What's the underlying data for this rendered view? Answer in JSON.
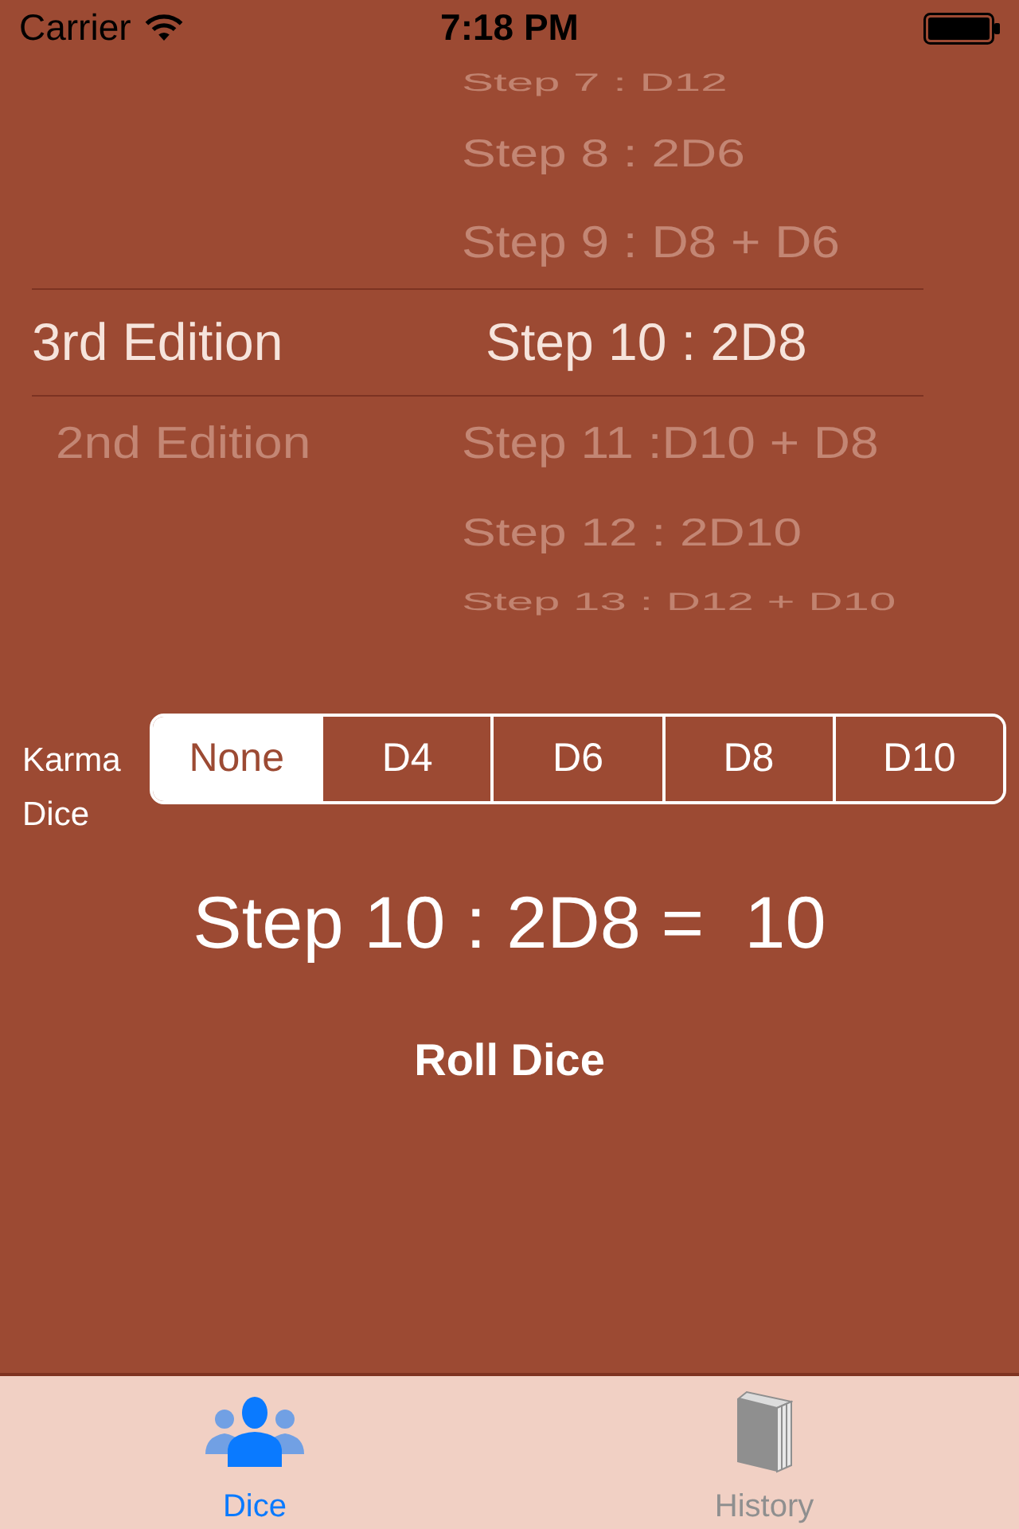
{
  "status_bar": {
    "carrier": "Carrier",
    "time": "7:18 PM"
  },
  "picker": {
    "editions": [
      {
        "label": "3rd Edition",
        "selected": true
      },
      {
        "label": "2nd Edition",
        "selected": false
      }
    ],
    "steps": [
      {
        "label": "Step 7 : D12",
        "selected": false
      },
      {
        "label": "Step 8 : 2D6",
        "selected": false
      },
      {
        "label": "Step 9 : D8 + D6",
        "selected": false
      },
      {
        "label": "Step 10 : 2D8",
        "selected": true
      },
      {
        "label": "Step 11 :D10 + D8",
        "selected": false
      },
      {
        "label": "Step 12 : 2D10",
        "selected": false
      },
      {
        "label": "Step 13 : D12 + D10",
        "selected": false
      }
    ]
  },
  "karma": {
    "label": "Karma Dice",
    "options": [
      {
        "label": "None",
        "selected": true
      },
      {
        "label": "D4",
        "selected": false
      },
      {
        "label": "D6",
        "selected": false
      },
      {
        "label": "D8",
        "selected": false
      },
      {
        "label": "D10",
        "selected": false
      }
    ]
  },
  "result": "Step 10 : 2D8 =  10",
  "roll_button": "Roll Dice",
  "tabs": [
    {
      "label": "Dice",
      "selected": true,
      "kind": "people"
    },
    {
      "label": "History",
      "selected": false,
      "kind": "book"
    }
  ]
}
